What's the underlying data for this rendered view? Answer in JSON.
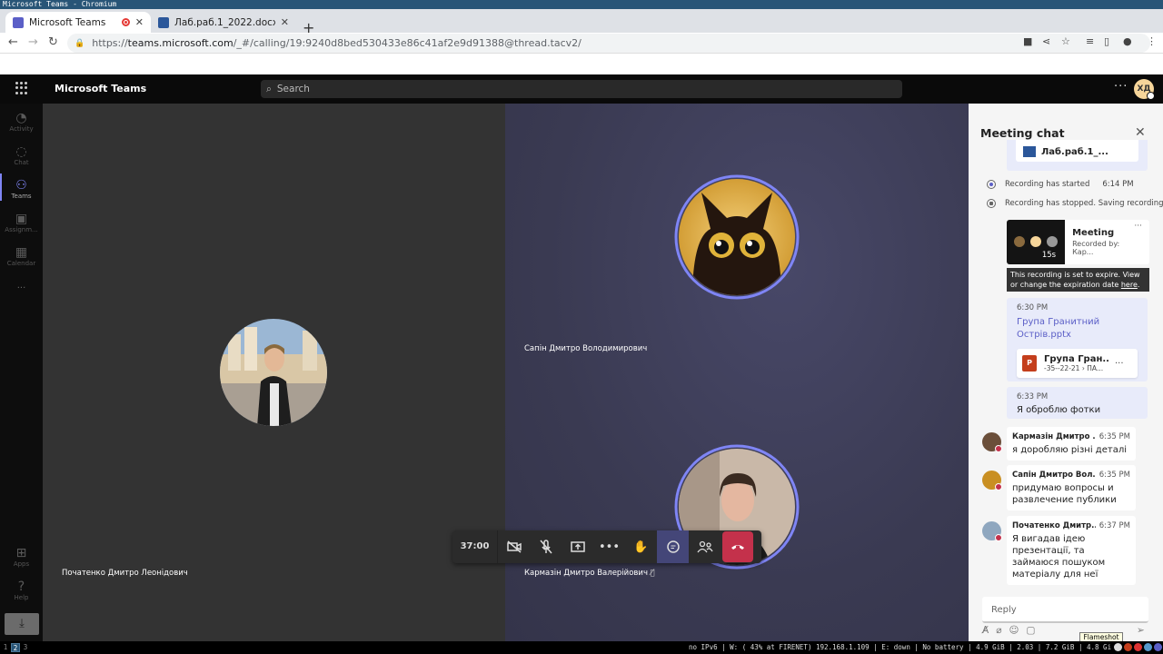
{
  "window_title": "Microsoft Teams - Chromium",
  "tabs": [
    {
      "label": "Microsoft Teams",
      "close": "✕"
    },
    {
      "label": "Лаб.раб.1_2022.docx",
      "close": "✕"
    }
  ],
  "new_tab": "+",
  "address": {
    "scheme": "https://",
    "host": "teams.microsoft.com",
    "path": "/_#/calling/19:9240d8bed530433e86c41af2e9d91388@thread.tacv2/"
  },
  "teams": {
    "app_name": "Microsoft Teams",
    "search_placeholder": "Search",
    "more": "···",
    "avatar_initials": "ХД"
  },
  "rail": [
    {
      "label": "Activity",
      "icon": "bell-icon"
    },
    {
      "label": "Chat",
      "icon": "chat-icon"
    },
    {
      "label": "Teams",
      "icon": "teams-icon"
    },
    {
      "label": "Assignm...",
      "icon": "backpack-icon"
    },
    {
      "label": "Calendar",
      "icon": "calendar-icon"
    },
    {
      "label": "···",
      "icon": "more-icon"
    },
    {
      "label": "Apps",
      "icon": "apps-icon"
    },
    {
      "label": "Help",
      "icon": "help-icon"
    }
  ],
  "participants": {
    "left": "Початенко Дмитро Леонідович",
    "right_top": "Сапін Дмитро Володимирович",
    "right_bottom": "Кармазін Дмитро Валерійович"
  },
  "call": {
    "timer": "37:00"
  },
  "chat": {
    "title": "Meeting chat",
    "top_file": "Лаб.раб.1_...",
    "system": [
      {
        "text": "Recording has started",
        "time": "6:14 PM"
      },
      {
        "text": "Recording has stopped. Saving recording..."
      }
    ],
    "recording": {
      "title": "Meeting",
      "by": "Recorded by: Кар...",
      "duration": "15s",
      "more": "···"
    },
    "tooltip": {
      "text": "This recording is set to expire. View or change the expiration date ",
      "link": "here",
      "end": "."
    },
    "mine": [
      {
        "time": "6:30 PM",
        "link": "Група Гранитний Острів.pptx",
        "file_name": "Група Гран...",
        "file_sub": "-35--22-21 › ПА..."
      },
      {
        "time": "6:33 PM",
        "text": "Я оброблю фотки"
      }
    ],
    "others": [
      {
        "name": "Кармазін Дмитро ...",
        "time": "6:35 PM",
        "text": "я доробляю різні деталі"
      },
      {
        "name": "Сапін Дмитро Вол...",
        "time": "6:35 PM",
        "text": "придумаю вопросы и развлечение публики"
      },
      {
        "name": "Початенко Дмитр...",
        "time": "6:37 PM",
        "text": "Я вигадав ідею презентації, та займаюся пошуком матеріалу для неї"
      }
    ],
    "reply_placeholder": "Reply"
  },
  "flameshot": "Flameshot",
  "status": {
    "workspaces": [
      "1",
      "2",
      "3"
    ],
    "right": "no IPv6 | W: ( 43% at FIRENET) 192.168.1.109 | E: down | No battery | 4.9 GiB | 2.03 | 7.2 GiB | 4.8 GiB | 2022-10-11 18:38:56"
  },
  "colors": {
    "accent": "#5b5fc7",
    "hangup": "#c4314b",
    "ring": "#7f85f5"
  }
}
